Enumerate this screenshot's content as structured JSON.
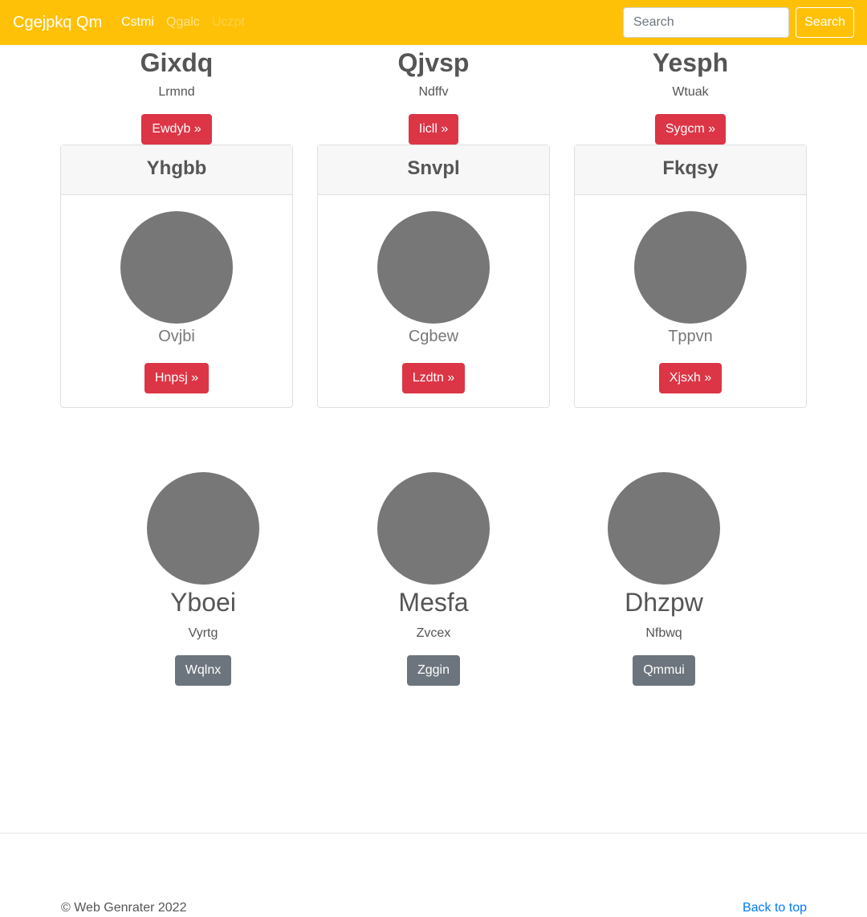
{
  "navbar": {
    "brand": "Cgejpkq Qm",
    "links": [
      "Cstmi",
      "Qgalc",
      "Uczpt"
    ],
    "search_placeholder": "Search",
    "search_button": "Search",
    "background": "#ffc107"
  },
  "headings": [
    {
      "title": "Gixdq",
      "subtitle": "Lrmnd",
      "button": "Ewdyb »"
    },
    {
      "title": "Qjvsp",
      "subtitle": "Ndffv",
      "button": "Iicll »"
    },
    {
      "title": "Yesph",
      "subtitle": "Wtuak",
      "button": "Sygcm »"
    }
  ],
  "cards": [
    {
      "header": "Yhgbb",
      "caption": "Ovjbi",
      "button": "Hnpsj »"
    },
    {
      "header": "Snvpl",
      "caption": "Cgbew",
      "button": "Lzdtn »"
    },
    {
      "header": "Fkqsy",
      "caption": "Tppvn",
      "button": "Xjsxh »"
    }
  ],
  "features": [
    {
      "title": "Yboei",
      "subtitle": "Vyrtg",
      "button": "Wqlnx"
    },
    {
      "title": "Mesfa",
      "subtitle": "Zvcex",
      "button": "Zggin"
    },
    {
      "title": "Dhzpw",
      "subtitle": "Nfbwq",
      "button": "Qmmui"
    }
  ],
  "footer": {
    "copyright": "© Web Genrater 2022",
    "back_to_top": "Back to top"
  },
  "colors": {
    "danger": "#dc3545",
    "secondary": "#6c757d",
    "placeholder_circle": "#777777",
    "link": "#007bff"
  }
}
